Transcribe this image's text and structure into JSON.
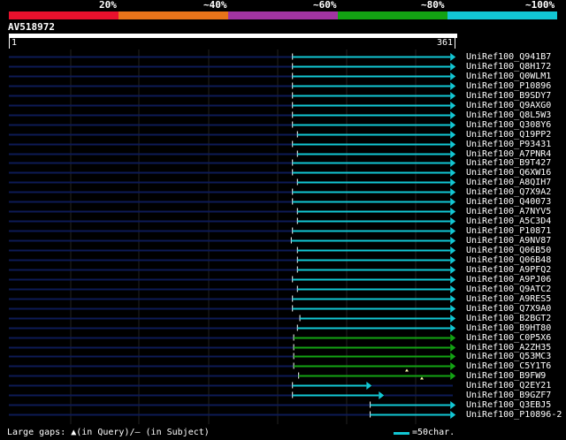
{
  "scale": {
    "labels": [
      "20%",
      "~40%",
      "~60%",
      "~80%",
      "~100%"
    ],
    "colors": [
      "#e8112d",
      "#e8741a",
      "#a234a2",
      "#13a313",
      "#12c7d4"
    ]
  },
  "query": {
    "title": "AV518972",
    "start": "1",
    "end": "361"
  },
  "hits": [
    {
      "label": "UniRef100_Q941B7",
      "start": 231,
      "end": 359,
      "color": "#12c7d4"
    },
    {
      "label": "UniRef100_Q8H172",
      "start": 231,
      "end": 359,
      "color": "#12c7d4"
    },
    {
      "label": "UniRef100_Q0WLM1",
      "start": 231,
      "end": 359,
      "color": "#12c7d4"
    },
    {
      "label": "UniRef100_P10896",
      "start": 231,
      "end": 359,
      "color": "#12c7d4"
    },
    {
      "label": "UniRef100_B9SDY7",
      "start": 231,
      "end": 359,
      "color": "#12c7d4"
    },
    {
      "label": "UniRef100_Q9AXG0",
      "start": 231,
      "end": 359,
      "color": "#12c7d4"
    },
    {
      "label": "UniRef100_Q8L5W3",
      "start": 231,
      "end": 359,
      "color": "#12c7d4"
    },
    {
      "label": "UniRef100_Q308Y6",
      "start": 231,
      "end": 359,
      "color": "#12c7d4"
    },
    {
      "label": "UniRef100_Q19PP2",
      "start": 235,
      "end": 359,
      "color": "#12c7d4"
    },
    {
      "label": "UniRef100_P93431",
      "start": 231,
      "end": 359,
      "color": "#12c7d4"
    },
    {
      "label": "UniRef100_A7PNR4",
      "start": 235,
      "end": 359,
      "color": "#12c7d4"
    },
    {
      "label": "UniRef100_B9T427",
      "start": 231,
      "end": 359,
      "color": "#12c7d4"
    },
    {
      "label": "UniRef100_Q6XW16",
      "start": 231,
      "end": 359,
      "color": "#12c7d4"
    },
    {
      "label": "UniRef100_A8QIH7",
      "start": 235,
      "end": 359,
      "color": "#12c7d4"
    },
    {
      "label": "UniRef100_Q7X9A2",
      "start": 231,
      "end": 359,
      "color": "#12c7d4"
    },
    {
      "label": "UniRef100_Q40073",
      "start": 231,
      "end": 359,
      "color": "#12c7d4"
    },
    {
      "label": "UniRef100_A7NYV5",
      "start": 235,
      "end": 359,
      "color": "#12c7d4"
    },
    {
      "label": "UniRef100_A5C3D4",
      "start": 235,
      "end": 359,
      "color": "#12c7d4"
    },
    {
      "label": "UniRef100_P10871",
      "start": 231,
      "end": 359,
      "color": "#12c7d4"
    },
    {
      "label": "UniRef100_A9NV87",
      "start": 230,
      "end": 359,
      "color": "#12c7d4"
    },
    {
      "label": "UniRef100_Q06B50",
      "start": 235,
      "end": 359,
      "color": "#12c7d4"
    },
    {
      "label": "UniRef100_Q06B48",
      "start": 235,
      "end": 359,
      "color": "#12c7d4"
    },
    {
      "label": "UniRef100_A9PFQ2",
      "start": 235,
      "end": 359,
      "color": "#12c7d4"
    },
    {
      "label": "UniRef100_A9PJ06",
      "start": 231,
      "end": 359,
      "color": "#12c7d4"
    },
    {
      "label": "UniRef100_Q9ATC2",
      "start": 235,
      "end": 359,
      "color": "#12c7d4"
    },
    {
      "label": "UniRef100_A9RES5",
      "start": 231,
      "end": 359,
      "color": "#12c7d4"
    },
    {
      "label": "UniRef100_Q7X9A0",
      "start": 231,
      "end": 359,
      "color": "#12c7d4"
    },
    {
      "label": "UniRef100_B2BGT2",
      "start": 237,
      "end": 359,
      "color": "#12c7d4"
    },
    {
      "label": "UniRef100_B9HT80",
      "start": 235,
      "end": 359,
      "color": "#12c7d4"
    },
    {
      "label": "UniRef100_C0P5X6",
      "start": 232,
      "end": 359,
      "color": "#13a313"
    },
    {
      "label": "UniRef100_A2ZH35",
      "start": 232,
      "end": 359,
      "color": "#13a313"
    },
    {
      "label": "UniRef100_Q53MC3",
      "start": 232,
      "end": 359,
      "color": "#13a313"
    },
    {
      "label": "UniRef100_C5Y1T6",
      "start": 232,
      "end": 359,
      "color": "#13a313"
    },
    {
      "label": "UniRef100_B9FW9",
      "start": 236,
      "end": 359,
      "color": "#13a313"
    },
    {
      "label": "UniRef100_Q2EY21",
      "start": 231,
      "end": 291,
      "color": "#12c7d4"
    },
    {
      "label": "UniRef100_B9GZF7",
      "start": 231,
      "end": 301,
      "color": "#12c7d4"
    },
    {
      "label": "UniRef100_Q3EBJ5",
      "start": 294,
      "end": 359,
      "color": "#12c7d4"
    },
    {
      "label": "UniRef100_P10896-2",
      "start": 294,
      "end": 359,
      "color": "#12c7d4"
    }
  ],
  "legend": {
    "gaps_text": "Large gaps: ▲(in Query)/— (in Subject)",
    "scale_text": "=50char."
  }
}
